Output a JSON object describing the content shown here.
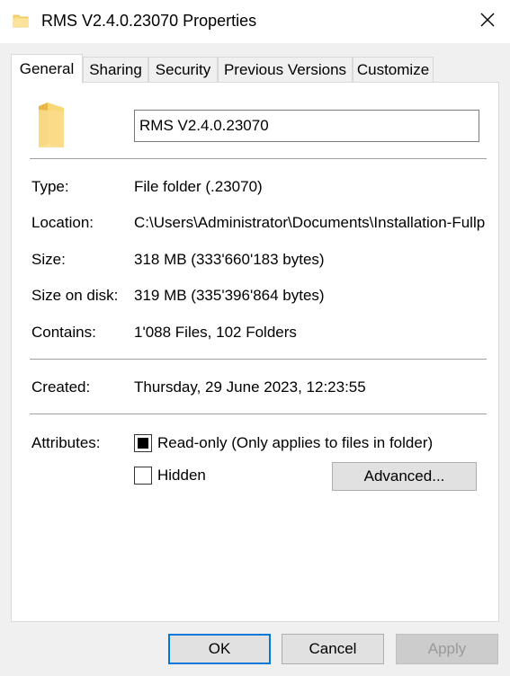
{
  "window": {
    "title": "RMS V2.4.0.23070 Properties",
    "icon": "folder-icon",
    "close_glyph": "✕"
  },
  "tabs": [
    {
      "label": "General",
      "active": true
    },
    {
      "label": "Sharing",
      "active": false
    },
    {
      "label": "Security",
      "active": false
    },
    {
      "label": "Previous Versions",
      "active": false
    },
    {
      "label": "Customize",
      "active": false
    }
  ],
  "general": {
    "name_value": "RMS V2.4.0.23070",
    "type_label": "Type:",
    "type_value": "File folder (.23070)",
    "location_label": "Location:",
    "location_value": "C:\\Users\\Administrator\\Documents\\Installation-Fullp",
    "size_label": "Size:",
    "size_value": "318 MB (333'660'183 bytes)",
    "size_on_disk_label": "Size on disk:",
    "size_on_disk_value": "319 MB (335'396'864 bytes)",
    "contains_label": "Contains:",
    "contains_value": "1'088 Files, 102 Folders",
    "created_label": "Created:",
    "created_value": "Thursday, 29 June 2023, 12:23:55",
    "attributes_label": "Attributes:",
    "readonly_label": "Read-only (Only applies to files in folder)",
    "readonly_state": "indeterminate",
    "hidden_label": "Hidden",
    "hidden_checked": false,
    "advanced_label": "Advanced..."
  },
  "footer": {
    "ok_label": "OK",
    "cancel_label": "Cancel",
    "apply_label": "Apply",
    "apply_enabled": false
  },
  "colors": {
    "folder": "#f8d775",
    "folder_dark": "#e8b64a",
    "accent": "#0078d7"
  }
}
